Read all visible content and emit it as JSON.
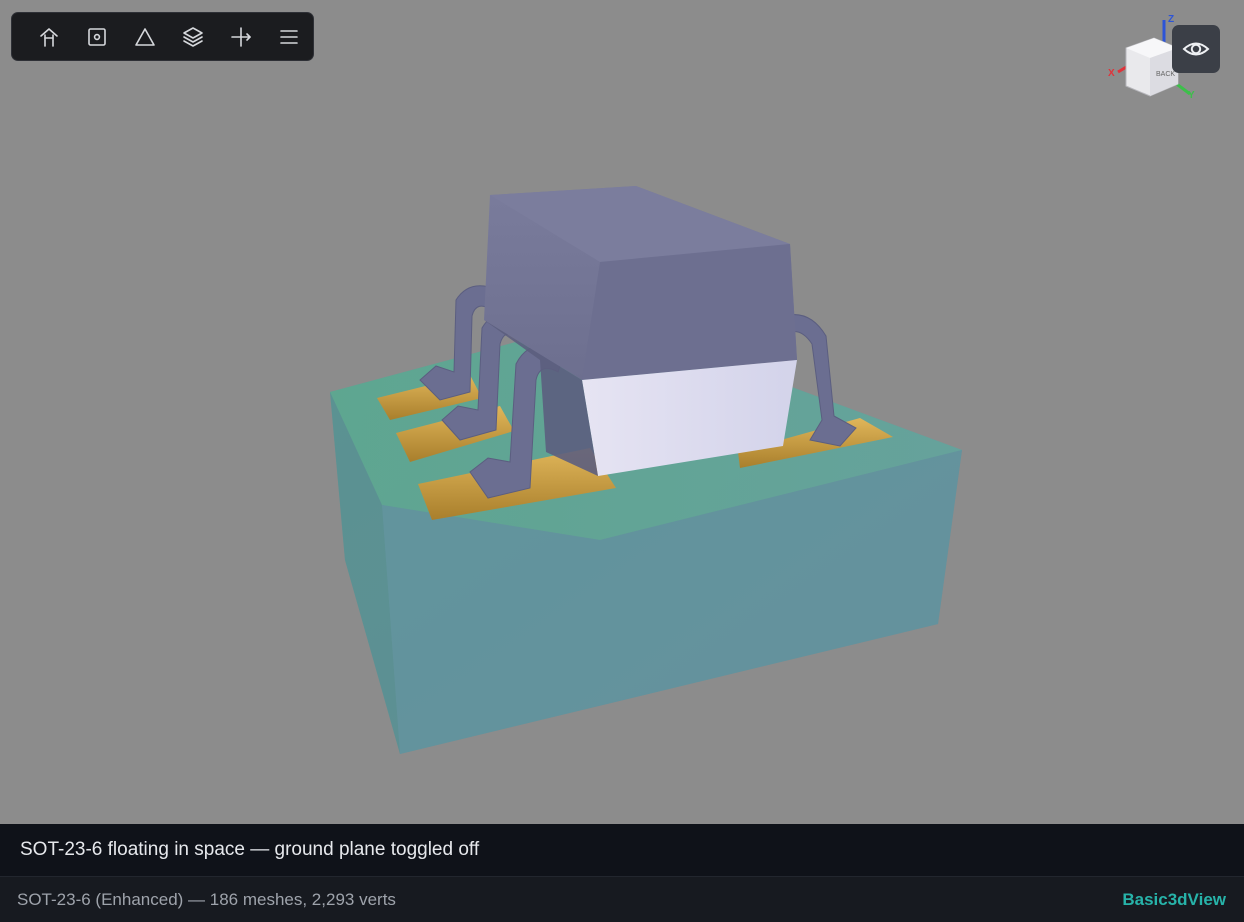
{
  "viewer": {
    "background_color": "#8c8c8c",
    "toolbar": {
      "buttons": [
        {
          "name": "home",
          "icon": "home-icon"
        },
        {
          "name": "top-view",
          "icon": "square-view-icon"
        },
        {
          "name": "wireframe",
          "icon": "triangle-icon"
        },
        {
          "name": "layers",
          "icon": "layers-icon"
        },
        {
          "name": "axes",
          "icon": "axis-icon"
        },
        {
          "name": "menu",
          "icon": "menu-icon"
        }
      ]
    },
    "view_cube": {
      "face_label": "BACK",
      "axes": [
        "X",
        "Y",
        "Z"
      ]
    },
    "visibility_button": {
      "icon": "eye-icon"
    },
    "model": {
      "body_color": "#6f7090",
      "lead_color": "#6b6e91",
      "pad_color": "#c89b3c",
      "board_color": "#5f9e9a"
    }
  },
  "caption": {
    "text": "SOT-23-6 floating in space — ground plane toggled off"
  },
  "status": {
    "model_info": "SOT-23-6 (Enhanced) — 186 meshes, 2,293 verts",
    "brand": "Basic3dView",
    "brand_color": "#27b3a9"
  }
}
